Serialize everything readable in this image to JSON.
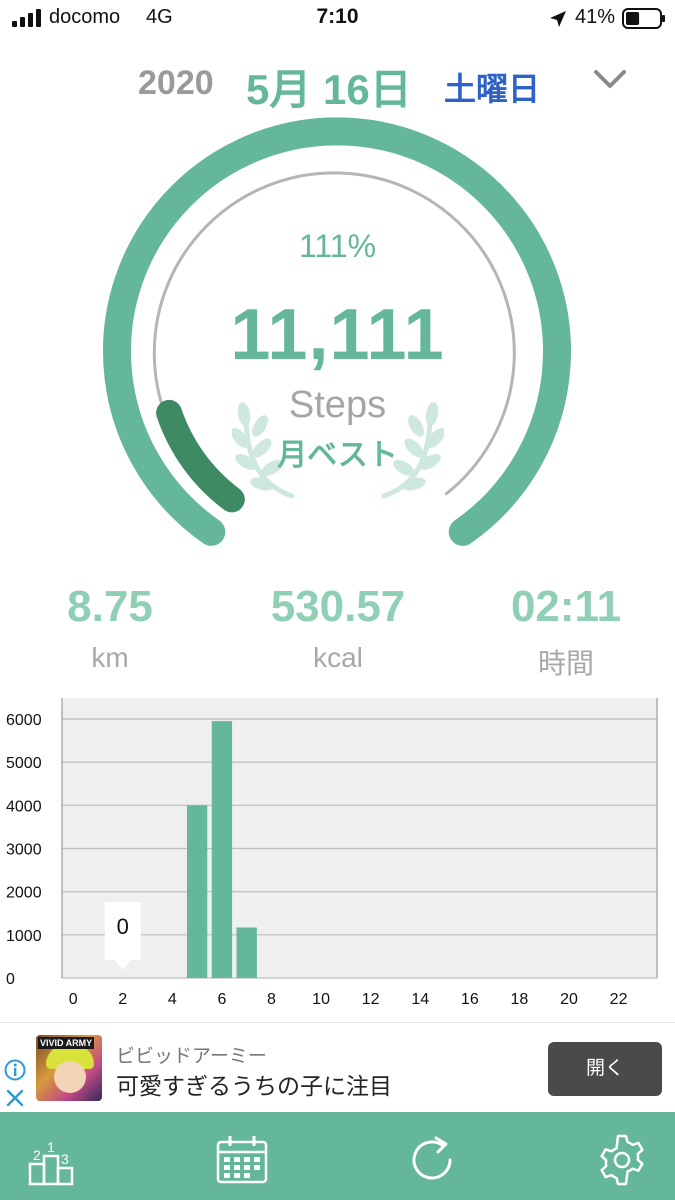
{
  "status_bar": {
    "carrier": "docomo",
    "network": "4G",
    "time": "7:10",
    "battery": "41%",
    "battery_level": 0.41,
    "icons": [
      "signal-icon",
      "location-arrow-icon",
      "battery-icon"
    ]
  },
  "date_header": {
    "year": "2020",
    "month_day": "5月 16日",
    "weekday": "土曜日"
  },
  "gauge": {
    "percent_label": "111%",
    "steps": "11,111",
    "unit": "Steps",
    "badge": "月ベスト",
    "progress": 1.11,
    "colors": {
      "progress": "#65b79b",
      "overflow": "#3e8a62",
      "track": "#b5b5b5"
    }
  },
  "stats": [
    {
      "value": "8.75",
      "label": "km"
    },
    {
      "value": "530.57",
      "label": "kcal"
    },
    {
      "value": "02:11",
      "label": "時間"
    }
  ],
  "chart_data": {
    "type": "bar",
    "x": [
      0,
      1,
      2,
      3,
      4,
      5,
      6,
      7,
      8,
      9,
      10,
      11,
      12,
      13,
      14,
      15,
      16,
      17,
      18,
      19,
      20,
      21,
      22,
      23
    ],
    "values": [
      0,
      0,
      0,
      0,
      0,
      4000,
      5950,
      1170,
      0,
      0,
      0,
      0,
      0,
      0,
      0,
      0,
      0,
      0,
      0,
      0,
      0,
      0,
      0,
      0
    ],
    "x_ticks": [
      "0",
      "2",
      "4",
      "6",
      "8",
      "10",
      "12",
      "14",
      "16",
      "18",
      "20",
      "22"
    ],
    "y_ticks": [
      "0",
      "1000",
      "2000",
      "3000",
      "4000",
      "5000",
      "6000"
    ],
    "ylim": [
      0,
      6000
    ],
    "grid": true,
    "bar_color": "#65b79b",
    "background": "#efefef",
    "tooltip": {
      "x": 2,
      "label": "0"
    }
  },
  "ad": {
    "thumb_text": "VIVID ARMY",
    "brand": "ビビッドアーミー",
    "title": "可愛すぎるうちの子に注目",
    "button": "開く"
  },
  "tab_bar": {
    "color": "#65b79b",
    "tabs": [
      {
        "icon": "ranking-podium-icon",
        "numbers": [
          "2",
          "1",
          "3"
        ]
      },
      {
        "icon": "calendar-icon"
      },
      {
        "icon": "refresh-icon"
      },
      {
        "icon": "gear-icon"
      }
    ]
  }
}
